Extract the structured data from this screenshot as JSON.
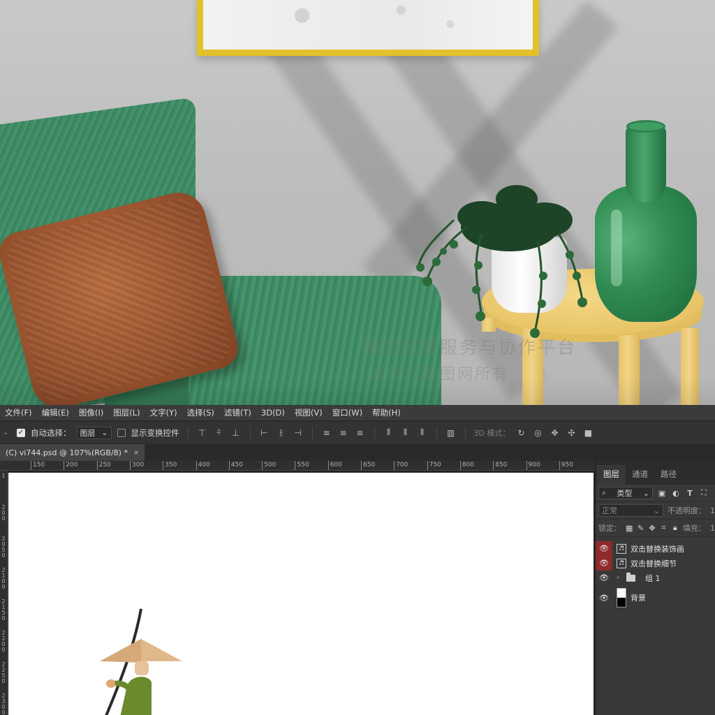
{
  "scene": {
    "watermark_line1": "图图创意服务与协作平台",
    "watermark_line2": "版权归图图网所有",
    "colors": {
      "wall": "#c2c2c2",
      "frame": "#e3c12b",
      "chair": "#3f8a63",
      "pillow": "#9c5530",
      "table": "#edc96f",
      "vase": "#2f8b52"
    }
  },
  "menubar": {
    "items": [
      "文件(F)",
      "编辑(E)",
      "图像(I)",
      "图层(L)",
      "文字(Y)",
      "选择(S)",
      "滤镜(T)",
      "3D(D)",
      "视图(V)",
      "窗口(W)",
      "帮助(H)"
    ]
  },
  "options": {
    "auto_select_label": "自动选择：",
    "auto_select_value": "图层",
    "show_transform_label": "显示变换控件",
    "mode_3d_label": "3D 模式："
  },
  "document": {
    "tab_title": "(C) vi744.psd @ 107%(RGB/8) *",
    "close_glyph": "×"
  },
  "ruler": {
    "top_labels": [
      "150",
      "200",
      "250",
      "300",
      "350",
      "400",
      "450",
      "500",
      "550",
      "600",
      "650",
      "700",
      "750",
      "800",
      "850",
      "900",
      "950"
    ],
    "left_labels": [
      "1",
      "200",
      "2050",
      "2100",
      "2150",
      "2200",
      "2250",
      "2300"
    ]
  },
  "layers_panel": {
    "tabs": [
      "图层",
      "通道",
      "路径"
    ],
    "filter_value": "类型",
    "blend_mode": "正常",
    "opacity_label": "不透明度：",
    "opacity_value": "1",
    "lock_label": "锁定：",
    "fill_label": "填充：",
    "fill_value": "1",
    "layers": [
      {
        "name": "双击替换装饰画",
        "kind": "smart",
        "visible": true,
        "highlighted": true
      },
      {
        "name": "双击替换细节",
        "kind": "smart",
        "visible": true,
        "highlighted": true
      },
      {
        "name": "组 1",
        "kind": "group",
        "visible": true,
        "highlighted": false
      },
      {
        "name": "背景",
        "kind": "background",
        "visible": true,
        "highlighted": false
      }
    ]
  },
  "canvas": {
    "background": "#ffffff",
    "illustration": "figure-with-conical-hat"
  }
}
